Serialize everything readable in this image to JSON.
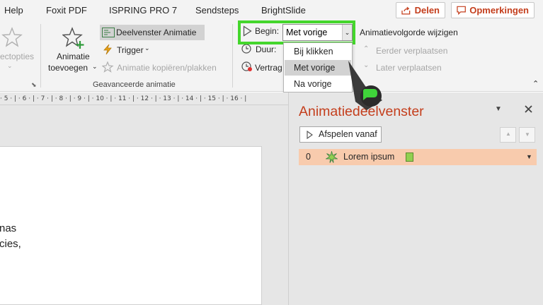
{
  "tabs": [
    "Help",
    "Foxit PDF",
    "ISPRING PRO 7",
    "Sendsteps",
    "BrightSlide"
  ],
  "top_buttons": {
    "share": "Delen",
    "comments": "Opmerkingen"
  },
  "ribbon": {
    "effect_options": "ectopties",
    "add_animation_line1": "Animatie",
    "add_animation_line2": "toevoegen",
    "animation_pane_button": "Deelvenster Animatie",
    "trigger": "Trigger",
    "animation_painter": "Animatie kopiëren/plakken",
    "group_advanced": "Geavanceerde animatie",
    "begin_label": "Begin:",
    "begin_value": "Met vorige",
    "duration_label": "Duur:",
    "delay_label": "Vertrag",
    "reorder_title": "Animatievolgorde wijzigen",
    "move_earlier": "Eerder verplaatsen",
    "move_later": "Later verplaatsen"
  },
  "begin_options": [
    "Bij klikken",
    "Met vorige",
    "Na vorige"
  ],
  "begin_selected": "Met vorige",
  "ruler": "· 5 · | · 6 · | · 7 · | · 8 · | · 9 · | · 10 · | · 11 · | · 12 · | · 13 · | · 14 · | · 15 · | · 16 · |",
  "slide_text": {
    "line1": "nas",
    "line2": "cies,"
  },
  "pane": {
    "title": "Animatiedeelvenster",
    "play_from": "Afspelen vanaf",
    "item": {
      "number": "0",
      "name": "Lorem ipsum"
    }
  },
  "colors": {
    "accent": "#c43e1c",
    "highlight": "#44d62c",
    "row_selected": "#f8cbad",
    "timing_bar": "#92d050"
  },
  "icons": [
    "share-icon",
    "comment-icon",
    "star-icon",
    "add-animation-star-icon",
    "animation-pane-icon",
    "lightning-icon",
    "paintbrush-icon",
    "play-triangle-icon",
    "clock-icon",
    "delay-clock-icon",
    "chevron-up-icon",
    "chevron-down-icon",
    "close-icon",
    "effect-star-icon",
    "cursor-bubble-icon"
  ]
}
